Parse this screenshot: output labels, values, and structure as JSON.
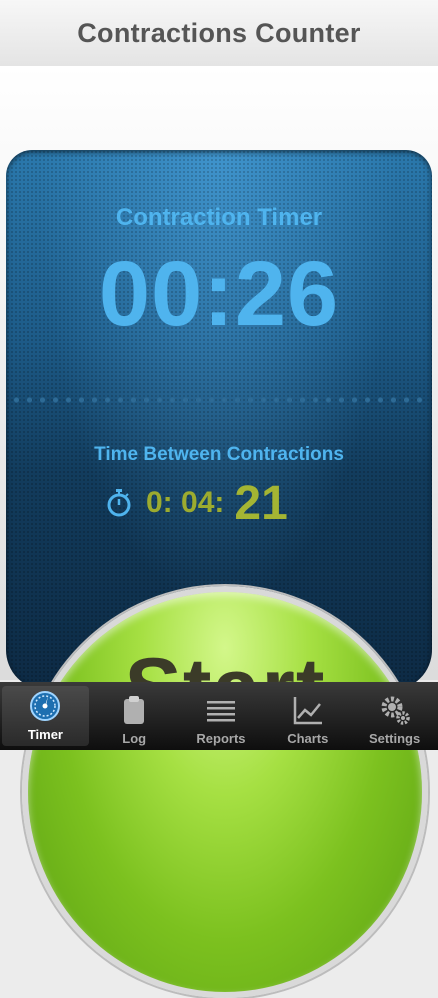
{
  "navbar": {
    "title": "Contractions Counter"
  },
  "timer": {
    "label": "Contraction Timer",
    "value": "00:26"
  },
  "between": {
    "label": "Time Between Contractions",
    "prefix": "0: 04:",
    "seconds": "21"
  },
  "start_button": {
    "label": "Start"
  },
  "tabs": [
    {
      "label": "Timer",
      "icon": "gauge-icon",
      "active": true
    },
    {
      "label": "Log",
      "icon": "clipboard-icon",
      "active": false
    },
    {
      "label": "Reports",
      "icon": "list-icon",
      "active": false
    },
    {
      "label": "Charts",
      "icon": "line-chart-icon",
      "active": false
    },
    {
      "label": "Settings",
      "icon": "gears-icon",
      "active": false
    }
  ],
  "colors": {
    "accent_blue": "#4fb4ee",
    "accent_green": "#a4b533",
    "start_green": "#7cc11f"
  }
}
